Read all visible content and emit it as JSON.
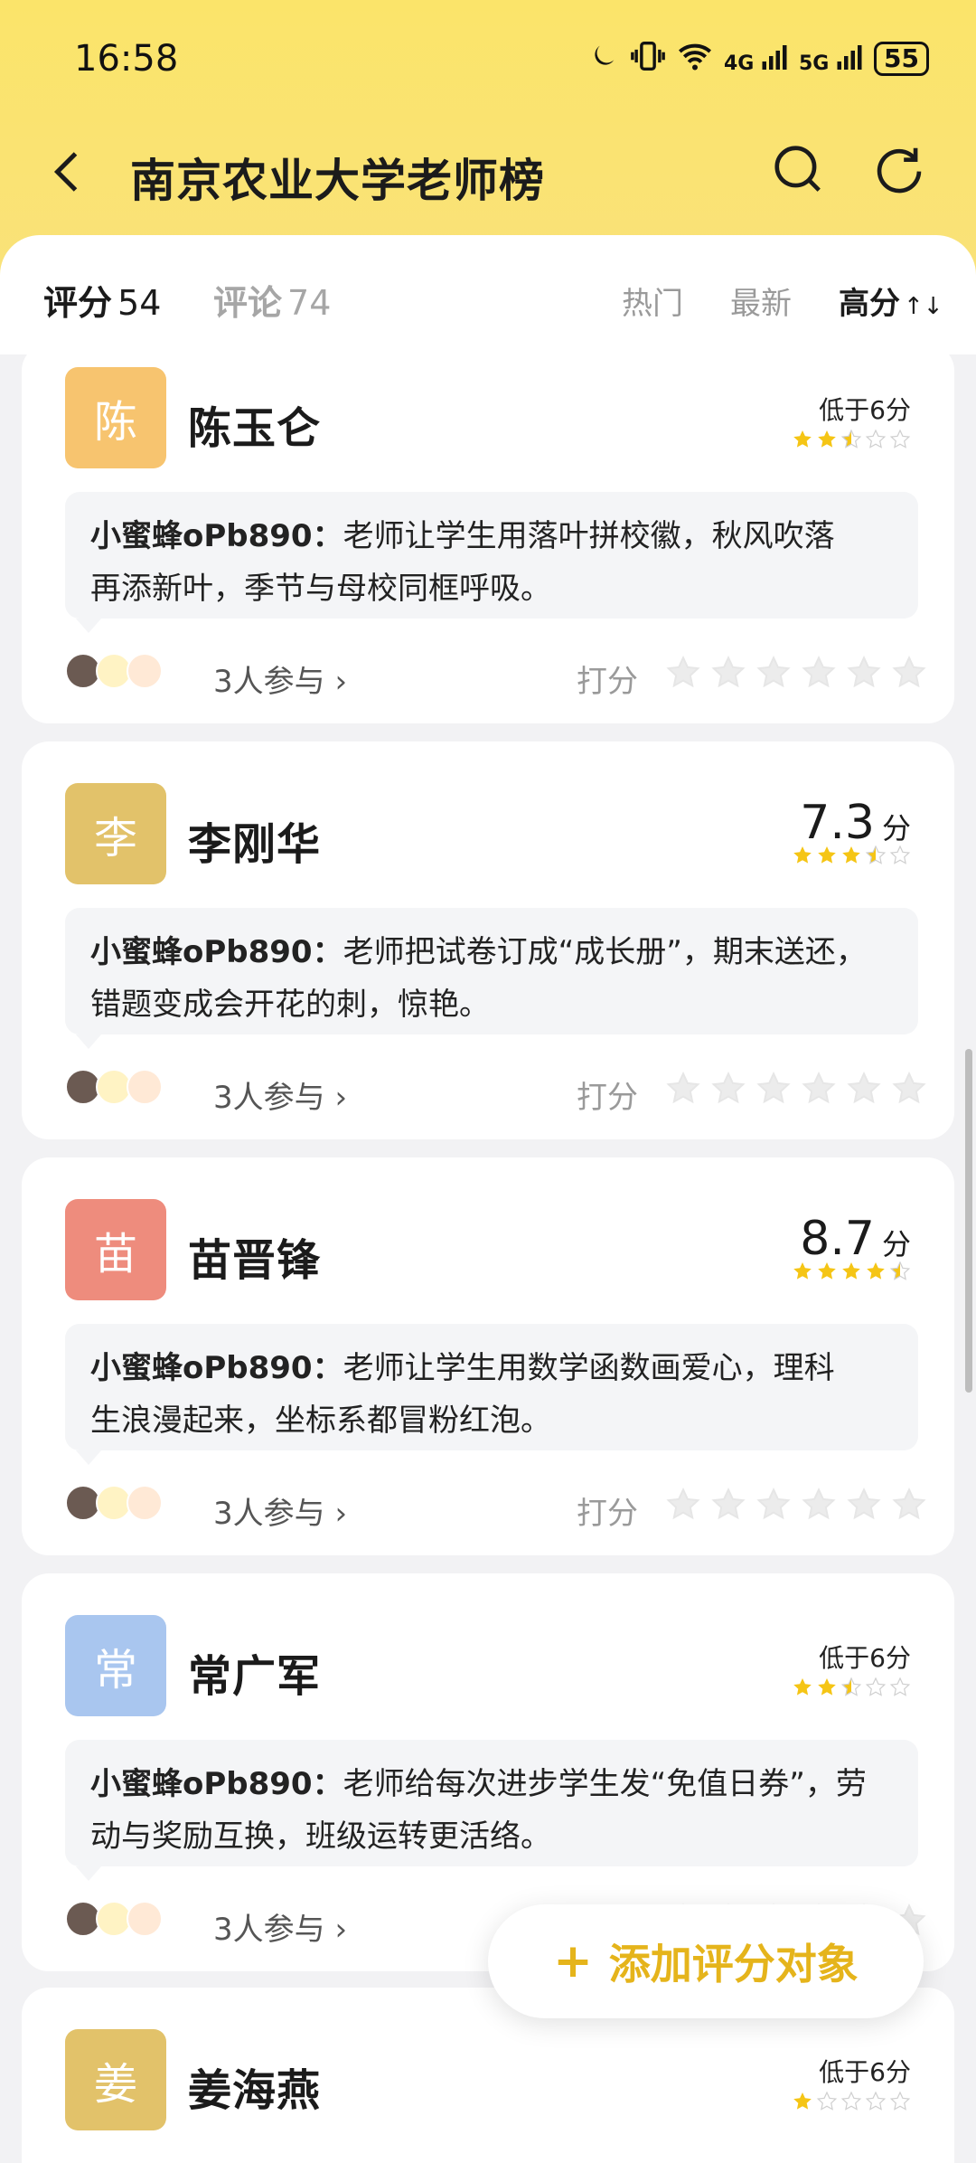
{
  "status": {
    "time": "16:58",
    "network_4g": "4G",
    "network_5g": "5G",
    "battery": "55"
  },
  "nav": {
    "title": "南京农业大学老师榜"
  },
  "tabs": {
    "rating_label": "评分",
    "rating_count": "54",
    "comments_label": "评论",
    "comments_count": "74"
  },
  "sort": {
    "hot": "热门",
    "new": "最新",
    "high": "高分",
    "high_icon": "↑↓"
  },
  "colors": {
    "header_yellow": "#fbe46a",
    "accent_gold": "#e5b41b",
    "star_yellow": "#f5c515"
  },
  "teachers": [
    {
      "avatar_char": "陈",
      "avatar_color": "#f7c46f",
      "name": "陈玉仑",
      "score_text": "低于6分",
      "stars": 2.5,
      "comment_author": "小蜜蜂oPb890：",
      "comment_line1": "老师让学生用落叶拼校徽，秋风吹落",
      "comment_line2": "再添新叶，季节与母校同框呼吸。",
      "participants": "3人参与"
    },
    {
      "avatar_char": "李",
      "avatar_color": "#e2c26a",
      "name": "李刚华",
      "score_value": "7.3",
      "score_unit": "分",
      "stars": 3.5,
      "comment_author": "小蜜蜂oPb890：",
      "comment_line1": "老师把试卷订成“成长册”，期末送还，",
      "comment_line2": "错题变成会开花的刺，惊艳。",
      "participants": "3人参与"
    },
    {
      "avatar_char": "苗",
      "avatar_color": "#ee8c7d",
      "name": "苗晋锋",
      "score_value": "8.7",
      "score_unit": "分",
      "stars": 4.5,
      "comment_author": "小蜜蜂oPb890：",
      "comment_line1": "老师让学生用数学函数画爱心，理科",
      "comment_line2": "生浪漫起来，坐标系都冒粉红泡。",
      "participants": "3人参与"
    },
    {
      "avatar_char": "常",
      "avatar_color": "#a9c6ef",
      "name": "常广军",
      "score_text": "低于6分",
      "stars": 2.5,
      "comment_author": "小蜜蜂oPb890：",
      "comment_line1": "老师给每次进步学生发“免值日券”，劳",
      "comment_line2": "动与奖励互换，班级运转更活络。",
      "participants": "3人参与"
    },
    {
      "avatar_char": "姜",
      "avatar_color": "#e2c26a",
      "name": "姜海燕",
      "score_text": "低于6分",
      "stars": 1
    }
  ],
  "rate_label": "打分",
  "fab": {
    "label": "添加评分对象",
    "plus": "+"
  }
}
